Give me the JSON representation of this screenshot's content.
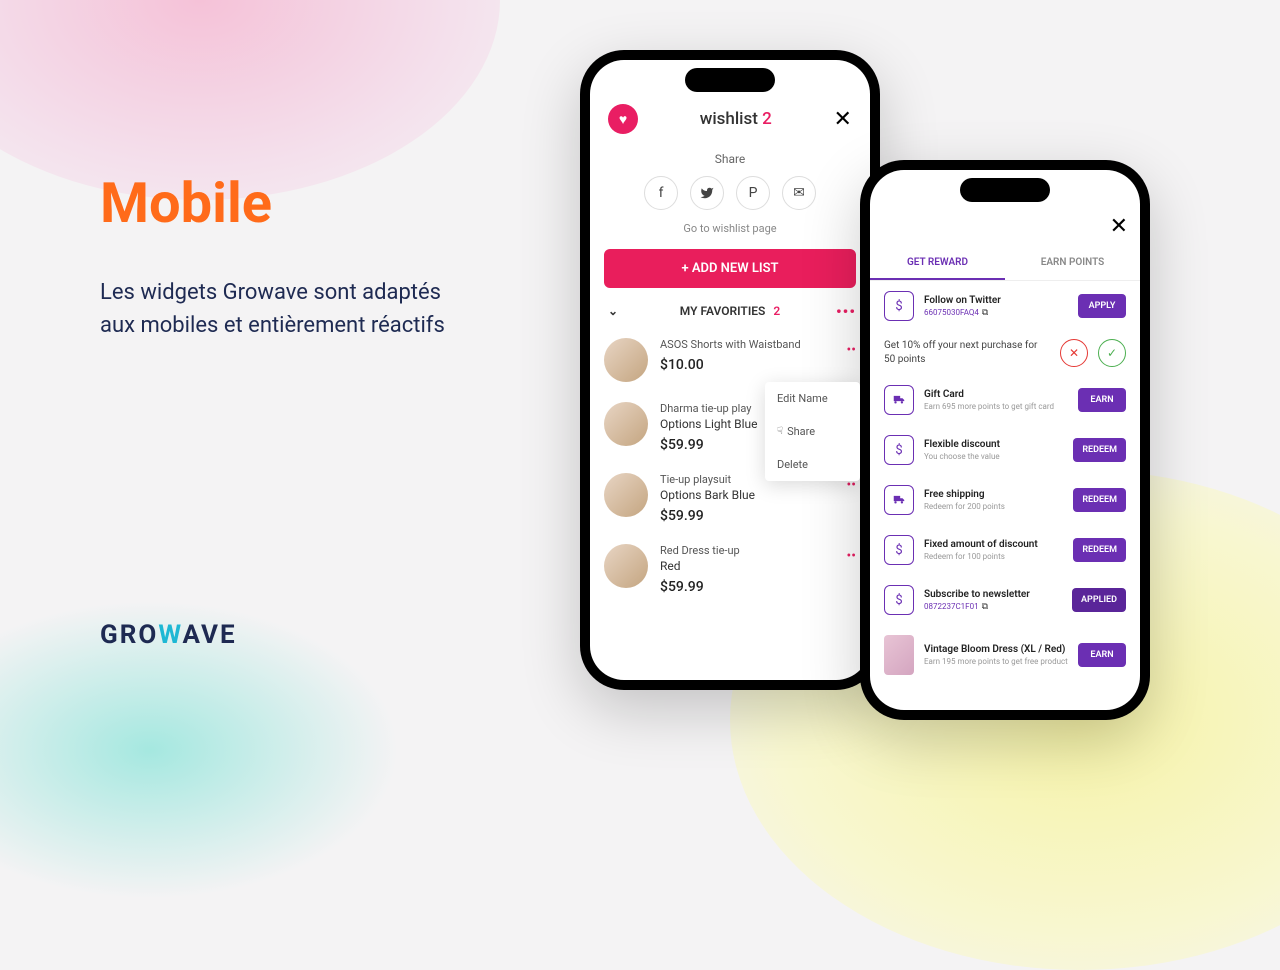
{
  "marketing": {
    "headline": "Mobile",
    "subtext": "Les widgets Growave sont adaptés aux mobiles et entièrement réactifs",
    "logo_pre": "GRO",
    "logo_wave": "W",
    "logo_post": "AVE"
  },
  "wishlist": {
    "title": "wishlist",
    "count": "2",
    "share_label": "Share",
    "goto": "Go to wishlist page",
    "add_btn": "+ ADD NEW LIST",
    "fav_label": "MY FAVORITIES",
    "fav_count": "2",
    "products": [
      {
        "name": "ASOS Shorts with Waistband",
        "opt": "",
        "price": "$10.00"
      },
      {
        "name": "Dharma tie-up play",
        "opt": "Options Light Blue",
        "price": "$59.99"
      },
      {
        "name": "Tie-up playsuit",
        "opt": "Options Bark Blue",
        "price": "$59.99"
      },
      {
        "name": "Red Dress tie-up",
        "opt": "Red",
        "price": "$59.99"
      }
    ],
    "ctx": {
      "edit": "Edit Name",
      "share": "Share",
      "delete": "Delete"
    }
  },
  "rewards": {
    "tab1": "GET REWARD",
    "tab2": "EARN POINTS",
    "offer": "Get 10% off your next purchase for 50 points",
    "items": [
      {
        "icon": "$",
        "title": "Follow on Twitter",
        "sub": "66075030FAQ4",
        "btn": "APPLY",
        "copy": true
      },
      {
        "icon": "truck",
        "title": "Gift Card",
        "sub": "Earn 695 more points to get gift card",
        "btn": "EARN",
        "gray": true
      },
      {
        "icon": "$",
        "title": "Flexible discount",
        "sub": "You choose the value",
        "btn": "REDEEM",
        "gray": true
      },
      {
        "icon": "truck",
        "title": "Free shipping",
        "sub": "Redeem for 200 points",
        "btn": "REDEEM",
        "gray": true
      },
      {
        "icon": "$",
        "title": "Fixed amount of discount",
        "sub": "Redeem for 100 points",
        "btn": "REDEEM",
        "gray": true
      },
      {
        "icon": "$",
        "title": "Subscribe to newsletter",
        "sub": "0872237C1F01",
        "btn": "APPLIED",
        "copy": true,
        "applied": true
      },
      {
        "icon": "img",
        "title": "Vintage Bloom Dress (XL / Red)",
        "sub": "Earn 195 more points to get free product",
        "btn": "EARN",
        "gray": true
      }
    ]
  }
}
